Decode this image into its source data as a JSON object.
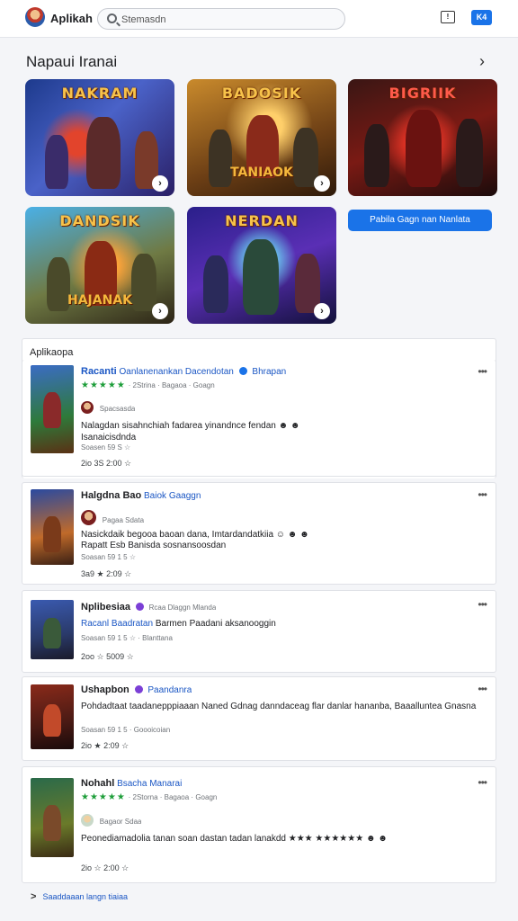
{
  "header": {
    "app_title": "Aplikah",
    "search_placeholder": "Stemasdn",
    "info_icon_label": "!",
    "action_button_label": "K4"
  },
  "featured": {
    "title": "Napaui Iranai",
    "arrow": "›",
    "tiles": [
      {
        "title": "NAKRAM",
        "subtitle": ""
      },
      {
        "title": "BADOSIK",
        "subtitle": "TANIAOK"
      },
      {
        "title": "BIGRIIK",
        "subtitle": ""
      },
      {
        "title": "DANDSIK",
        "subtitle": "HAJANAK"
      },
      {
        "title": "NERDAN",
        "subtitle": ""
      }
    ],
    "cta_label": "Pabila Gagn nan Nanlata"
  },
  "apps": {
    "section_title": "Aplikaopa",
    "items": [
      {
        "name": "Racanti",
        "developer": "Oanlanenankan Dacendotan",
        "tag": "Bhrapan",
        "stars": "★★★★★",
        "meta": "· 2Strina · Bagaoa · Goagn",
        "avatar_text": "Spacsasda",
        "description": "Nalagdan sisahnchiah fadarea yinandnce fendan ☻ ☻ Isanaicisdnda",
        "sub": "Soasen 59 S ☆",
        "stats": "2io  3S  2:00 ☆"
      },
      {
        "name": "Halgdna Bao",
        "developer": "Baiok",
        "tag": "Gaaggn",
        "stars": "",
        "meta": "",
        "avatar_text": "Pagaa Sdata",
        "description": "Nasickdaik begooa baoan dana, Imtardandatkiia ☺ ☻ ☻",
        "sub": "Rapatt Esb Banisda sosnansoosdan",
        "sub2": "Soasan 59 1 5 ☆",
        "stats": "3a9 ★  2:09 ☆"
      },
      {
        "name": "Nplibesiaa",
        "developer": "",
        "tag": "Rcaa Dlaggn Mlanda",
        "stars": "",
        "meta": "",
        "line2_a": "Racanl Baadratan",
        "line2_b": "Barmen Paadani aksanooggin",
        "sub": "Soasan 59 1 5 ☆  · Blanttana",
        "stats": "2oo ☆  5009 ☆"
      },
      {
        "name": "Ushapbon",
        "developer": "Paandanra",
        "tag": "",
        "stars": "",
        "meta": "",
        "description": "Pohdadtaat taadanepppiaaan Naned Gdnag danndaceag flar danlar hananba, Baaalluntea Gnasna",
        "sub": "Soasan 59 1 5 · Goooicoian",
        "stats": "2io ★  2:09 ☆"
      },
      {
        "name": "Nohahl",
        "developer": "Bsacha Manarai",
        "tag": "",
        "stars": "★★★★★",
        "meta": "· 2Storna · Bagaoa · Goagn",
        "avatar_text": "Bagaor Sdaa",
        "description": "Peonediamadolia tanan soan dastan tadan lanakdd ★★★ ★★★★★★ ☻ ☻",
        "sub": "",
        "stats": "2io ☆  2:00 ☆"
      }
    ],
    "see_more": "Saaddaaan langn tiaiaa",
    "see_more_arrow": ">",
    "more_icon": "•••"
  },
  "colors": {
    "accent": "#1a73e8",
    "star_green": "#1e9e3a",
    "developer_blue": "#1a56c4"
  }
}
